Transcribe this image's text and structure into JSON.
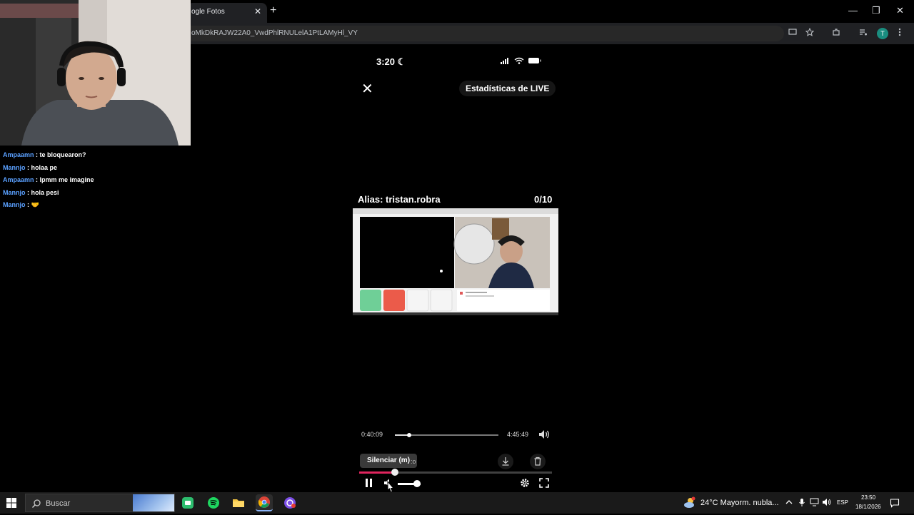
{
  "browser": {
    "tab_title": "ogle Fotos",
    "tab_close": "✕",
    "new_tab": "+",
    "url": "oMkDkRAJW22A0_VwdPhlRNULelA1PtLAMyHl_VY",
    "profile_initial": "T",
    "window_controls": {
      "minimize": "—",
      "restore": "❐",
      "close": "✕"
    }
  },
  "chat": {
    "messages": [
      {
        "user": "Ampaamn",
        "text": "te bloquearon?"
      },
      {
        "user": "Mannjo",
        "text": "holaa pe"
      },
      {
        "user": "Ampaamn",
        "text": "lpmm me imagine"
      },
      {
        "user": "Mannjo",
        "text": "hola pesi"
      },
      {
        "user": "Mannjo",
        "text": "🤝"
      }
    ],
    "separator": " : ",
    "user_color": "#5aa0ff"
  },
  "phone": {
    "time": "3:20",
    "moon": "☾",
    "close_icon": "✕",
    "live_stats_label": "Estadísticas de LIVE",
    "alias": "Alias: tristan.robra",
    "count": "0/10",
    "current_time": "0:40:09",
    "total_time": "4:45:49",
    "progress": 0.14
  },
  "player": {
    "tooltip": "Silenciar (m)",
    "tooltip_tail": ":o",
    "progress": 0.185,
    "volume": 0.85,
    "accent": "#e0245e"
  },
  "taskbar": {
    "search_placeholder": "Buscar",
    "weather": "24°C  Mayorm. nubla...",
    "language": "ESP",
    "time": "23:50",
    "date": "18/1/2026"
  }
}
